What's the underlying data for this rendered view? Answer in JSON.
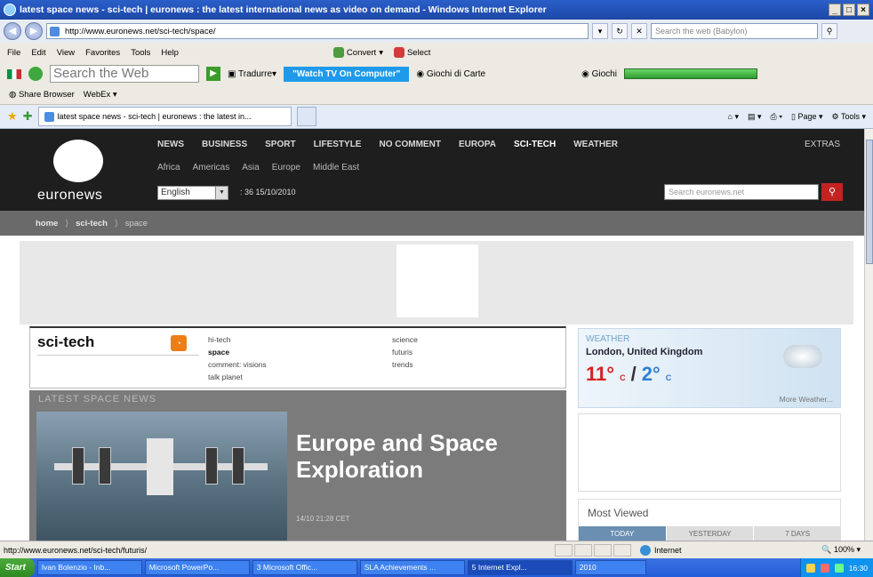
{
  "window": {
    "title": "latest space news - sci-tech | euronews : the latest international news as video on demand - Windows Internet Explorer",
    "controls": [
      "_",
      "□",
      "×"
    ]
  },
  "address_bar": {
    "url": "http://www.euronews.net/sci-tech/space/",
    "search_placeholder": "Search the web (Babylon)"
  },
  "menu": {
    "items": [
      "File",
      "Edit",
      "View",
      "Favorites",
      "Tools",
      "Help"
    ],
    "convert": "Convert",
    "select": "Select"
  },
  "toolbar2": {
    "search_placeholder": "Search the Web",
    "traduire": "Tradurre",
    "watch_tv": "\"Watch TV On Computer\"",
    "giochi_carte": "Giochi di Carte",
    "giochi": "Giochi"
  },
  "toolbar3": {
    "share_browser": "Share Browser",
    "webex": "WebEx"
  },
  "tabs": {
    "active_tab": "latest space news - sci-tech | euronews : the latest in...",
    "page_menu": "Page",
    "tools_menu": "Tools"
  },
  "site": {
    "logo": "euronews",
    "main_nav": [
      "NEWS",
      "BUSINESS",
      "SPORT",
      "LIFESTYLE",
      "NO COMMENT",
      "EUROPA",
      "SCI-TECH",
      "WEATHER"
    ],
    "extras": "EXTRAS",
    "sub_nav": [
      "Africa",
      "Americas",
      "Asia",
      "Europe",
      "Middle East"
    ],
    "language": "English",
    "datetime": ": 36 15/10/2010",
    "search_placeholder": "Search euronews.net",
    "breadcrumb": [
      "home",
      "sci-tech",
      "space"
    ]
  },
  "section": {
    "title": "sci-tech",
    "links_col1": [
      "hi-tech",
      "space",
      "comment: visions",
      "talk planet"
    ],
    "links_col2": [
      "science",
      "futuris",
      "trends"
    ],
    "active_link": "space"
  },
  "latest": {
    "label": "LATEST SPACE NEWS",
    "headline": "Europe and Space Exploration",
    "timestamp": "14/10 21:28 CET"
  },
  "weather": {
    "label": "WEATHER",
    "city": "London, United Kingdom",
    "high": "11°",
    "high_unit": "C",
    "low": "2°",
    "low_unit": "C",
    "more": "More Weather..."
  },
  "most_viewed": {
    "title": "Most Viewed",
    "tabs": [
      "TODAY",
      "YESTERDAY",
      "7 DAYS"
    ]
  },
  "status": {
    "url": "http://www.euronews.net/sci-tech/futuris/",
    "zone": "Internet",
    "zoom": "100%"
  },
  "taskbar": {
    "start": "Start",
    "tasks": [
      "Ivan Bolenzio - Inb...",
      "Microsoft PowerPo...",
      "3 Microsoft Offic...",
      "SLA Achievements ...",
      "5 Internet Expl...",
      "2010"
    ],
    "clock": "16:30"
  }
}
